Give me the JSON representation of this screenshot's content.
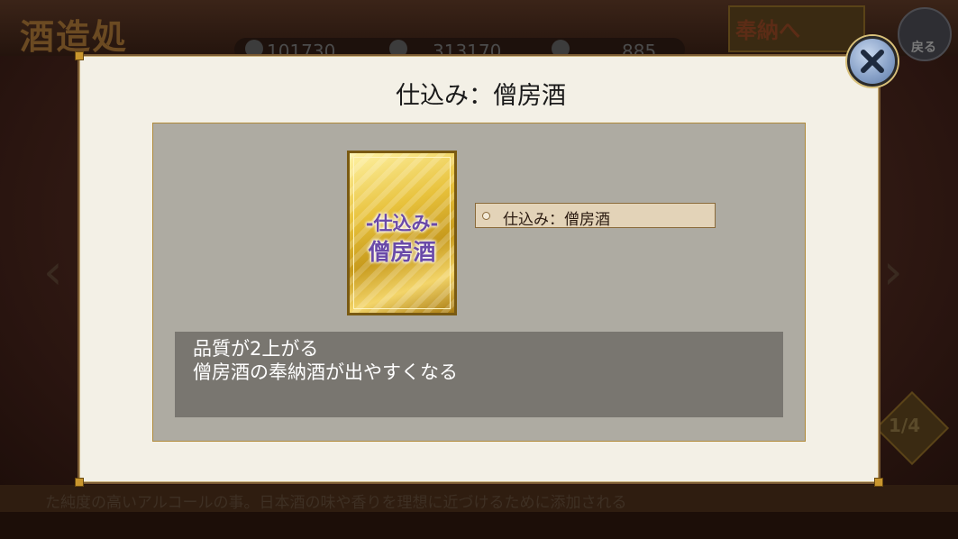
{
  "background": {
    "screen_title": "酒造処",
    "resources": [
      "101730",
      "313170",
      "885"
    ],
    "offer_button_label": "奉納へ",
    "back_button_label": "戻る",
    "page_indicator": "1/4",
    "footer_text": "た純度の高いアルコールの事。日本酒の味や香りを理想に近づけるために添加される"
  },
  "modal": {
    "title": "仕込み：僧房酒",
    "card": {
      "line1": "-仕込み-",
      "line2": "僧房酒"
    },
    "item_name": "仕込み：僧房酒",
    "description": [
      "品質が2上がる",
      "僧房酒の奉納酒が出やすくなる"
    ],
    "close_icon": "close-x-icon"
  },
  "colors": {
    "modal_bg": "#f3f0e6",
    "panel_bg": "#aeaba2",
    "desc_bg": "#797670",
    "card_gold": "#e8c23c",
    "card_text": "#6a4aa8",
    "close_button": "#8aa3c9"
  }
}
